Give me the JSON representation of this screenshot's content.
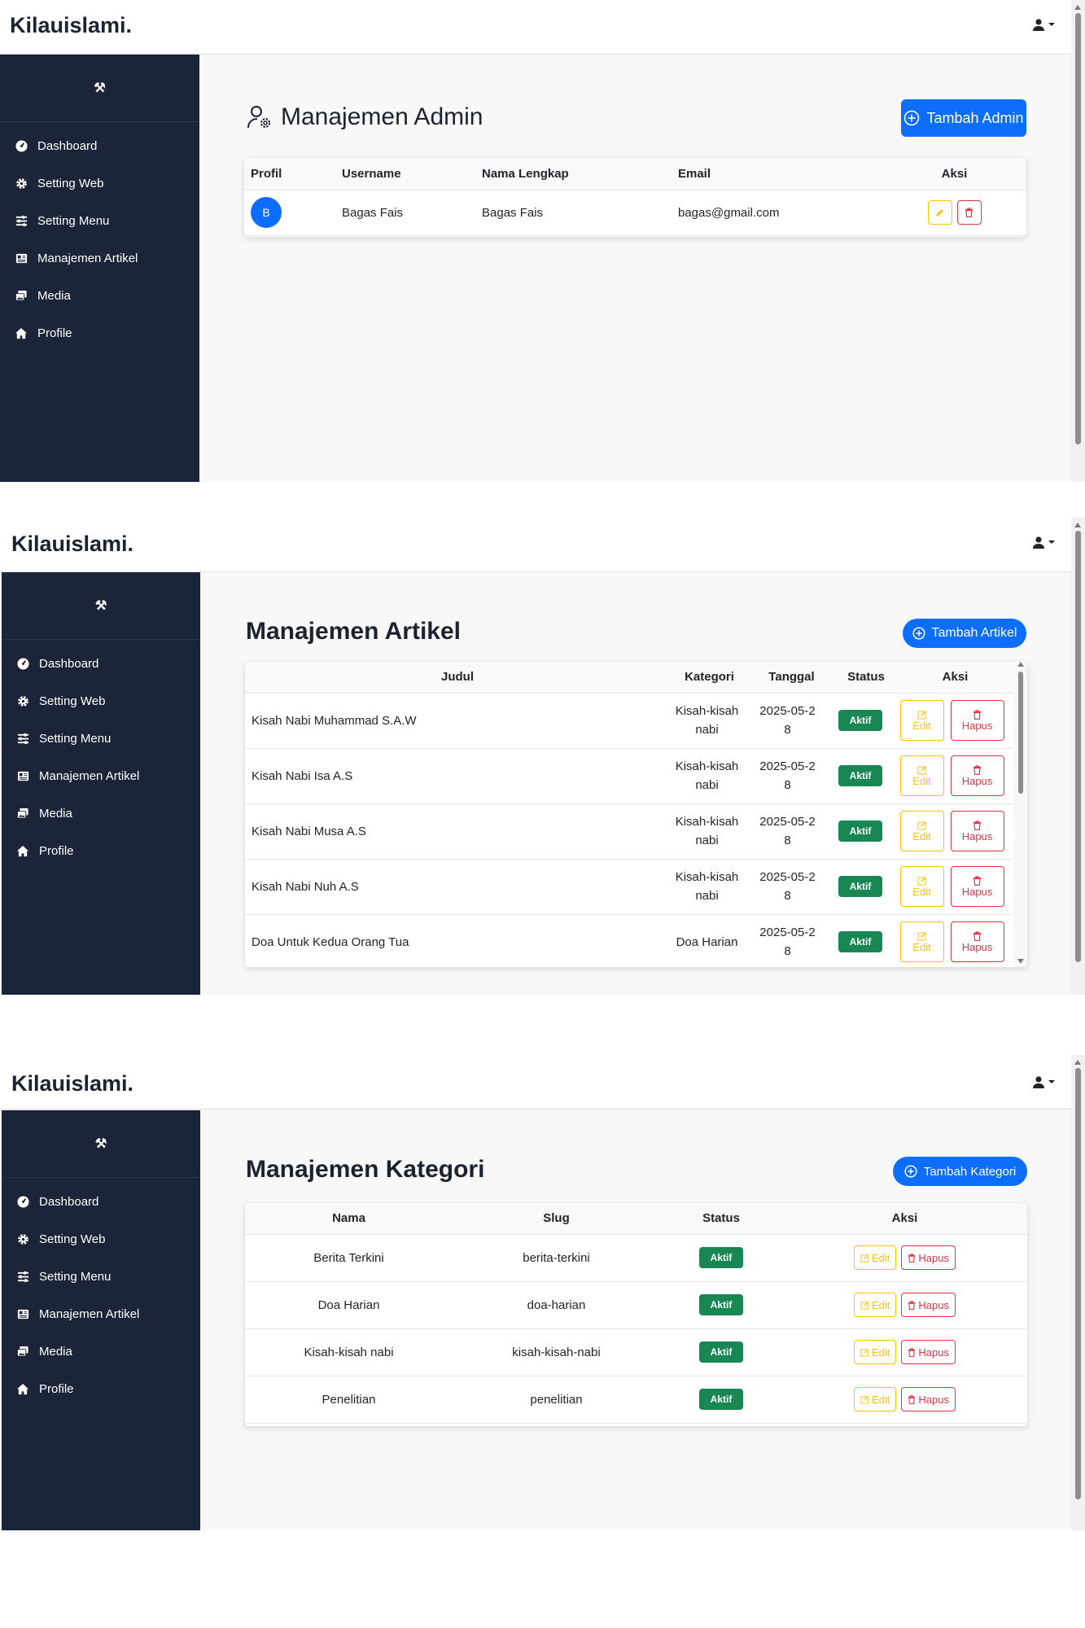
{
  "brand": "Kilauislami.",
  "sidebar": {
    "items": [
      {
        "label": "Dashboard",
        "icon": "dashboard-gauge-icon"
      },
      {
        "label": "Setting Web",
        "icon": "gear-icon"
      },
      {
        "label": "Setting Menu",
        "icon": "sliders-icon"
      },
      {
        "label": "Manajemen Artikel",
        "icon": "newspaper-icon"
      },
      {
        "label": "Media",
        "icon": "images-icon"
      },
      {
        "label": "Profile",
        "icon": "home-icon"
      }
    ]
  },
  "admin": {
    "title": "Manajemen Admin",
    "add_button": "Tambah Admin",
    "headers": [
      "Profil",
      "Username",
      "Nama Lengkap",
      "Email",
      "Aksi"
    ],
    "rows": [
      {
        "avatar": "B",
        "username": "Bagas Fais",
        "fullname": "Bagas Fais",
        "email": "bagas@gmail.com"
      }
    ]
  },
  "artikel": {
    "title": "Manajemen Artikel",
    "add_button": "Tambah Artikel",
    "headers": [
      "Judul",
      "Kategori",
      "Tanggal",
      "Status",
      "Aksi"
    ],
    "edit_label": "Edit",
    "delete_label": "Hapus",
    "rows": [
      {
        "judul": "Kisah Nabi Muhammad S.A.W",
        "kategori": "Kisah-kisah nabi",
        "tanggal": "2025-05-28",
        "status": "Aktif"
      },
      {
        "judul": "Kisah Nabi Isa A.S",
        "kategori": "Kisah-kisah nabi",
        "tanggal": "2025-05-28",
        "status": "Aktif"
      },
      {
        "judul": "Kisah Nabi Musa A.S",
        "kategori": "Kisah-kisah nabi",
        "tanggal": "2025-05-28",
        "status": "Aktif"
      },
      {
        "judul": "Kisah Nabi Nuh A.S",
        "kategori": "Kisah-kisah nabi",
        "tanggal": "2025-05-28",
        "status": "Aktif"
      },
      {
        "judul": "Doa Untuk Kedua Orang Tua",
        "kategori": "Doa Harian",
        "tanggal": "2025-05-28",
        "status": "Aktif"
      }
    ]
  },
  "kategori": {
    "title": "Manajemen Kategori",
    "add_button": "Tambah Kategori",
    "headers": [
      "Nama",
      "Slug",
      "Status",
      "Aksi"
    ],
    "edit_label": "Edit",
    "delete_label": "Hapus",
    "rows": [
      {
        "nama": "Berita Terkini",
        "slug": "berita-terkini",
        "status": "Aktif"
      },
      {
        "nama": "Doa Harian",
        "slug": "doa-harian",
        "status": "Aktif"
      },
      {
        "nama": "Kisah-kisah nabi",
        "slug": "kisah-kisah-nabi",
        "status": "Aktif"
      },
      {
        "nama": "Penelitian",
        "slug": "penelitian",
        "status": "Aktif"
      }
    ]
  },
  "colors": {
    "sidebar": "#1b2438",
    "primary": "#0d6efd",
    "success": "#198754",
    "warning": "#ffc107",
    "danger": "#dc3545"
  }
}
